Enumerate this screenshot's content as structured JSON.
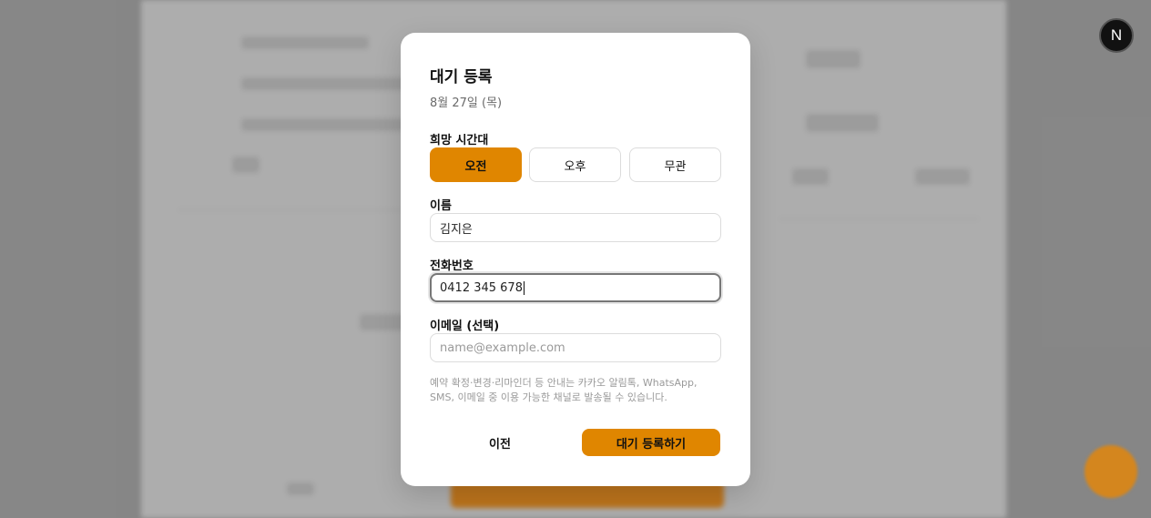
{
  "modal": {
    "title": "대기 등록",
    "date": "8월 27일 (목)",
    "time_label": "희망 시간대",
    "time_options": [
      "오전",
      "오후",
      "무관"
    ],
    "time_selected": "오전",
    "name_label": "이름",
    "name_value": "김지은",
    "phone_label": "전화번호",
    "phone_value": "0412 345 678",
    "email_label": "이메일 (선택)",
    "email_placeholder": "name@example.com",
    "note": "예약 확정·변경·리마인더 등 안내는 카카오 알림톡, WhatsApp, SMS, 이메일 중 이용 가능한 채널로 발송될 수 있습니다.",
    "prev_label": "이전",
    "submit_label": "대기 등록하기"
  },
  "badge": {
    "letter": "N"
  },
  "colors": {
    "accent": "#e08600",
    "overlay": "#8f8f8f"
  }
}
